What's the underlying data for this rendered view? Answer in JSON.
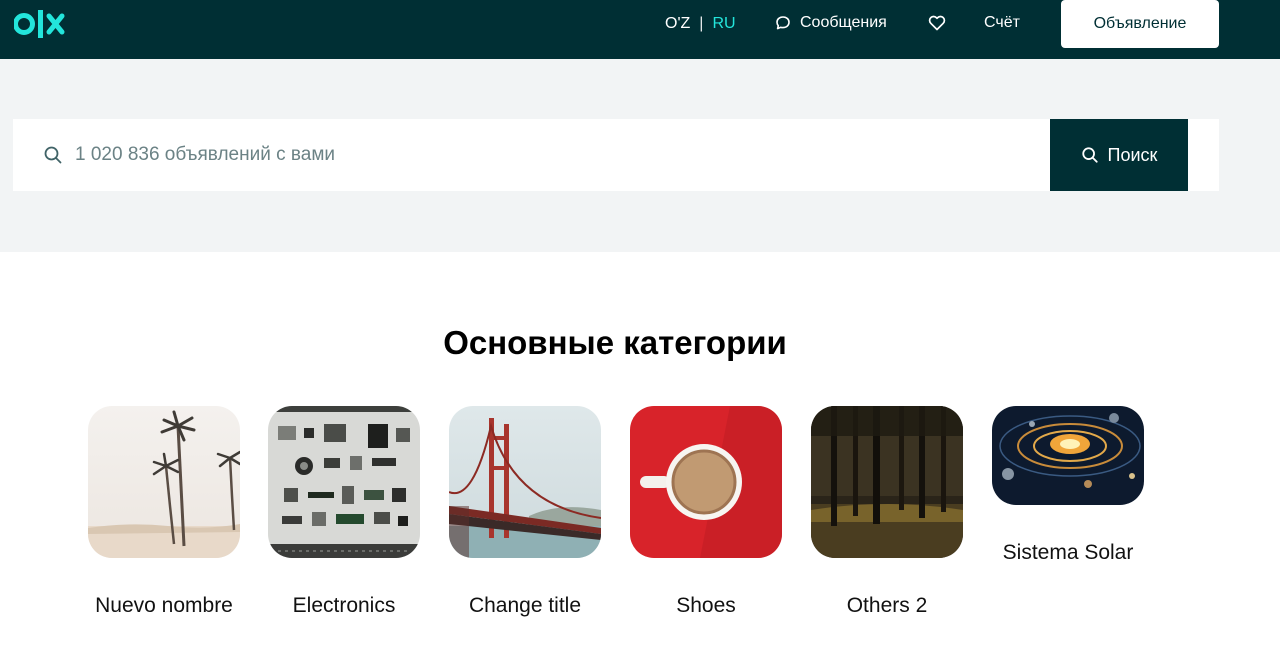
{
  "header": {
    "logo": "olx-logo",
    "lang_uz": "O'Z",
    "lang_sep": "|",
    "lang_ru": "RU",
    "messages_label": "Сообщения",
    "favorites_icon": "heart-icon",
    "account_label": "Счёт",
    "post_label": "Объявление"
  },
  "search": {
    "placeholder": "1 020 836 объявлений с вами",
    "button_label": "Поиск"
  },
  "categories": {
    "title": "Основные категории",
    "items": [
      {
        "label": "Nuevo nombre",
        "image": "palm-trees-beach"
      },
      {
        "label": "Electronics",
        "image": "electronic-components"
      },
      {
        "label": "Change title",
        "image": "golden-gate-bridge"
      },
      {
        "label": "Shoes",
        "image": "coffee-cup-red"
      },
      {
        "label": "Others 2",
        "image": "dark-forest"
      },
      {
        "label": "Sistema Solar",
        "image": "solar-system"
      }
    ]
  },
  "colors": {
    "brand_dark": "#002f34",
    "accent_teal": "#23e5db",
    "band_gray": "#f2f4f5"
  }
}
